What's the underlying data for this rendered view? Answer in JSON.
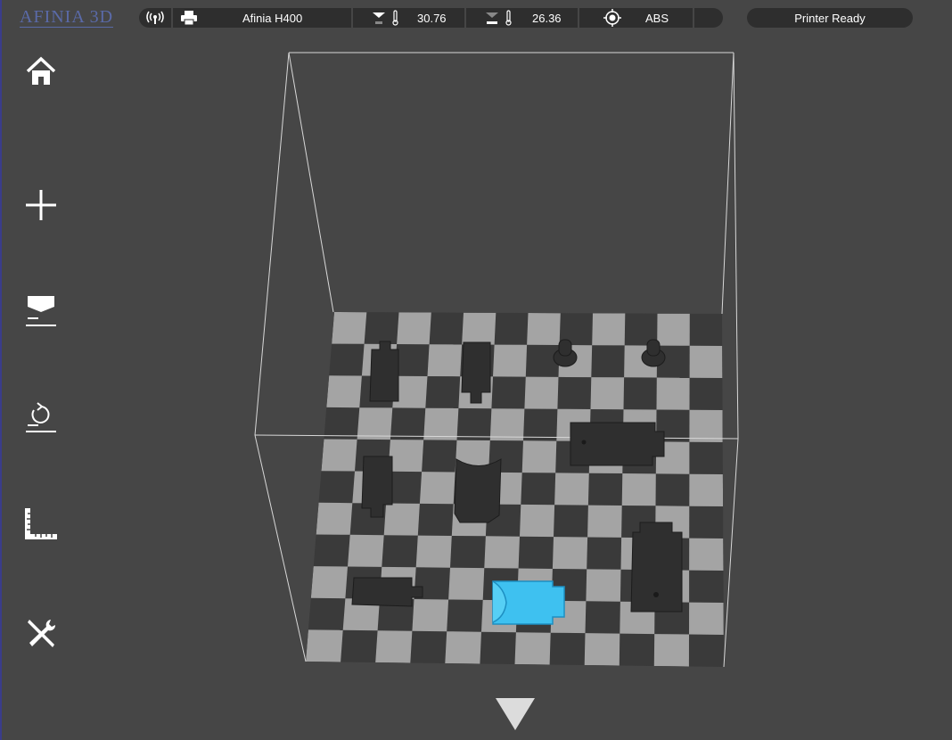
{
  "app": {
    "logo_text": "AFINIA 3D"
  },
  "topbar": {
    "printer_name": "Afinia H400",
    "nozzle_temp": "30.76",
    "bed_temp": "26.36",
    "material": "ABS"
  },
  "status": {
    "text": "Printer Ready"
  },
  "icons": {
    "wireless": "wireless-icon",
    "printer": "printer-icon",
    "nozzle_temp": "nozzle-thermometer-icon",
    "bed_temp": "bed-thermometer-icon",
    "material": "filament-target-icon",
    "home": "home-icon",
    "add": "plus-icon",
    "print": "print-layer-icon",
    "maintenance": "rotate-platform-icon",
    "calibrate": "ruler-icon",
    "settings": "tools-icon",
    "more": "triangle-down-icon"
  },
  "colors": {
    "background": "#464646",
    "bar": "#2e2e2e",
    "selected_model": "#3ec1f0",
    "model": "#2f2f2f"
  }
}
